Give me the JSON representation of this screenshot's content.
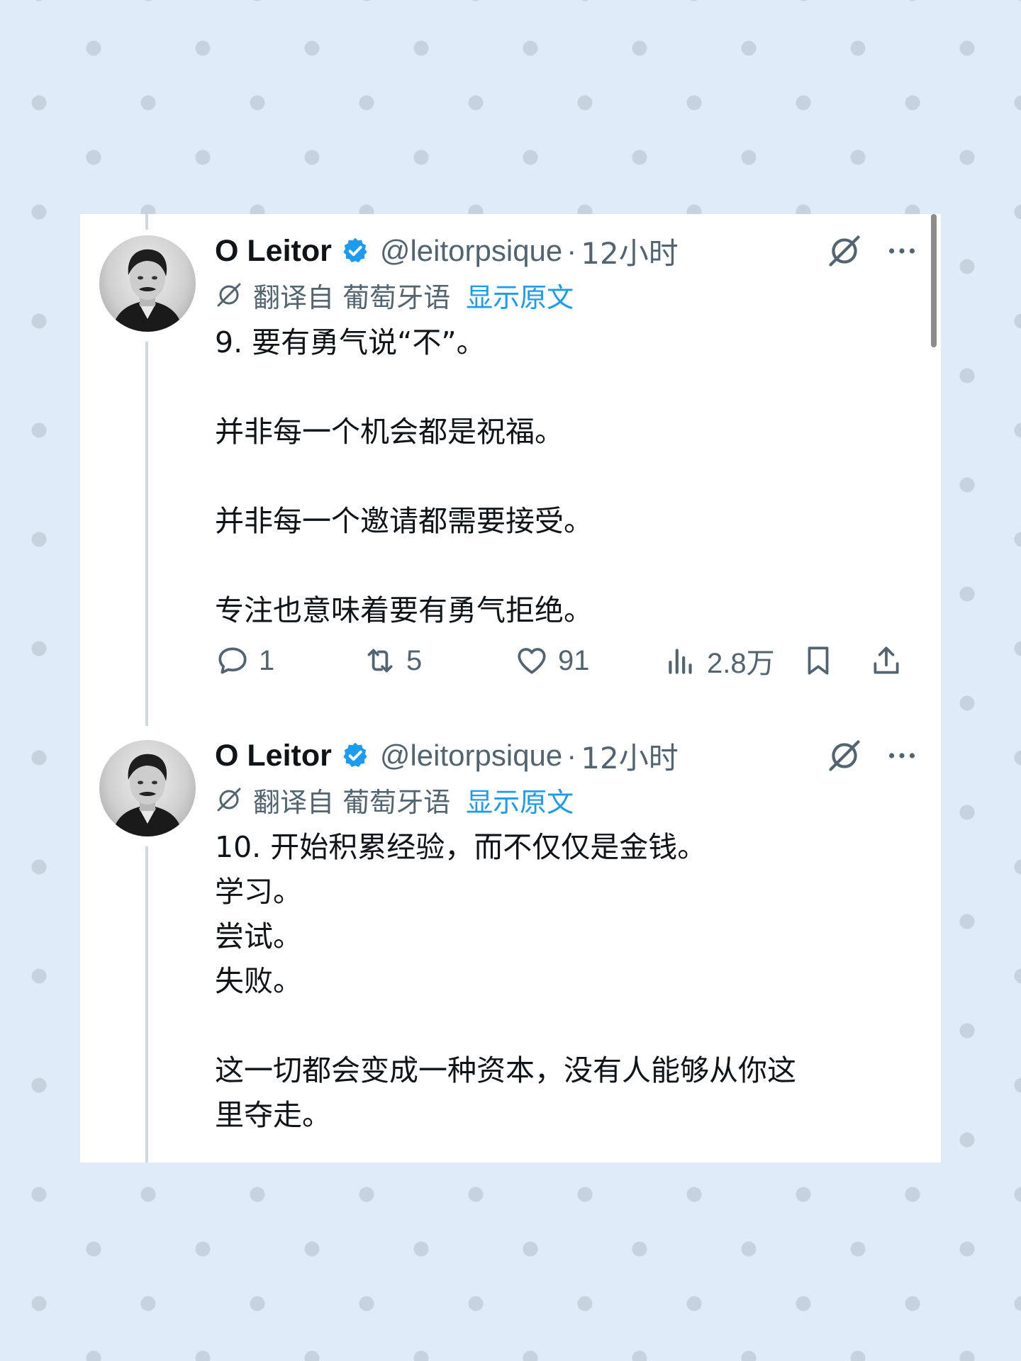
{
  "tweets": [
    {
      "author_name": "O Leitor",
      "handle": "@leitorpsique",
      "separator": "·",
      "time": "12小时",
      "translated_label": "翻译自 葡萄牙语",
      "show_original_label": "显示原文",
      "lines": [
        "9. 要有勇气说“不”。",
        "",
        "并非每一个机会都是祝福。",
        "",
        "并非每一个邀请都需要接受。",
        "",
        "专注也意味着要有勇气拒绝。"
      ],
      "replies": "1",
      "reposts": "5",
      "likes": "91",
      "views": "2.8万"
    },
    {
      "author_name": "O Leitor",
      "handle": "@leitorpsique",
      "separator": "·",
      "time": "12小时",
      "translated_label": "翻译自 葡萄牙语",
      "show_original_label": "显示原文",
      "lines": [
        "10. 开始积累经验，而不仅仅是金钱。",
        "学习。",
        "尝试。",
        "失败。",
        "",
        "这一切都会变成一种资本，没有人能够从你这",
        "里夺走。"
      ]
    }
  ],
  "colors": {
    "background": "#deebf8",
    "accent": "#1d9bf0",
    "text": "#0f1419",
    "secondary": "#536471"
  },
  "icons": [
    "verified-badge-icon",
    "grok-icon",
    "more-icon",
    "translate-icon",
    "reply-icon",
    "repost-icon",
    "like-icon",
    "views-icon",
    "bookmark-icon",
    "share-icon"
  ]
}
